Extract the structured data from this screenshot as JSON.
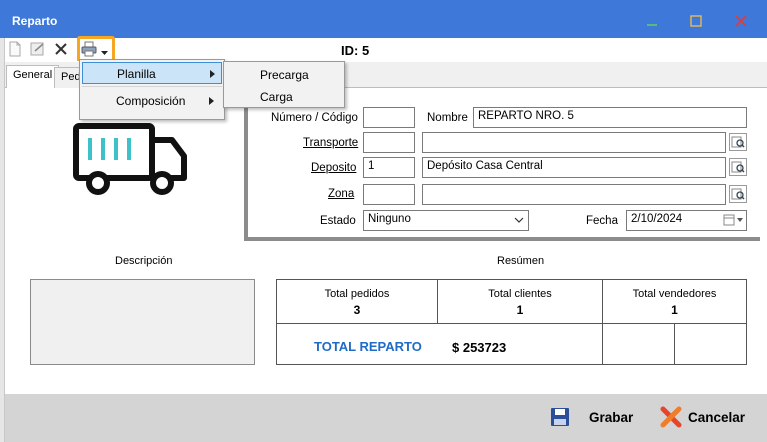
{
  "window": {
    "title": "Reparto"
  },
  "toolbar": {
    "id_text": "ID: 5"
  },
  "tabs": [
    "General",
    "Ped"
  ],
  "menu": {
    "items": [
      "Planilla",
      "Composición"
    ],
    "submenu_items": [
      "Precarga",
      "Carga"
    ]
  },
  "form": {
    "numero_label": "Número / Código",
    "numero_value": "",
    "nombre_label": "Nombre",
    "nombre_value": "REPARTO NRO. 5",
    "transporte_label": "Transporte",
    "transporte_code": "",
    "transporte_desc": "",
    "deposito_label": "Deposito",
    "deposito_code": "1",
    "deposito_desc": "Depósito Casa Central",
    "zona_label": "Zona",
    "zona_code": "",
    "zona_desc": "",
    "estado_label": "Estado",
    "estado_value": "Ninguno",
    "fecha_label": "Fecha",
    "fecha_value": "2/10/2024"
  },
  "descripcion": {
    "title": "Descripción"
  },
  "resumen": {
    "title": "Resúmen",
    "total_pedidos_label": "Total pedidos",
    "total_pedidos": "3",
    "total_clientes_label": "Total clientes",
    "total_clientes": "1",
    "total_vendedores_label": "Total vendedores",
    "total_vendedores": "1",
    "total_reparto_label": "TOTAL REPARTO",
    "total_reparto_value": "$ 253723"
  },
  "footer": {
    "grabar": "Grabar",
    "cancelar": "Cancelar"
  },
  "colors": {
    "titlebar": "#3e78d8",
    "accent_total": "#1f6bc5",
    "truck_teal": "#3fc1c9",
    "highlight_orange": "#f5a623"
  },
  "icons": [
    "new-icon",
    "edit-icon",
    "delete-icon",
    "printer-icon",
    "truck-icon",
    "lookup-icon",
    "calendar-icon",
    "save-icon",
    "cancel-icon"
  ]
}
